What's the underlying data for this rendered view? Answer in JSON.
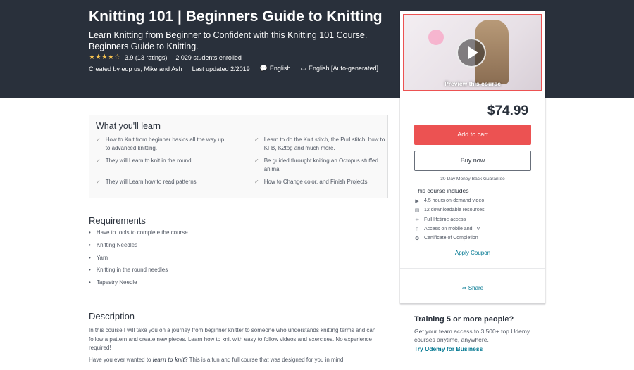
{
  "header": {
    "title": "Knitting 101 | Beginners Guide to Knitting",
    "subtitle": "Learn Knitting from Beginner to Confident with this Knitting 101 Course. Beginners Guide to Knitting.",
    "stars": "★★★★☆",
    "rating": "3.9 (13 ratings)",
    "enrolled": "2,029 students enrolled",
    "created_by": "Created by eqp us, Mike and Ash",
    "last_updated": "Last updated 2/2019",
    "language": "English",
    "captions": "English [Auto-generated]"
  },
  "sidebar": {
    "preview_label": "Preview this course",
    "price": "$74.99",
    "add_to_cart": "Add to cart",
    "buy_now": "Buy now",
    "guarantee": "30-Day Money-Back Guarantee",
    "includes_title": "This course includes",
    "includes": [
      {
        "icon": "video-icon",
        "glyph": "▶",
        "label": "4.5 hours on-demand video"
      },
      {
        "icon": "file-icon",
        "glyph": "▤",
        "label": "12 downloadable resources"
      },
      {
        "icon": "infinity-icon",
        "glyph": "∞",
        "label": "Full lifetime access"
      },
      {
        "icon": "mobile-icon",
        "glyph": "▯",
        "label": "Access on mobile and TV"
      },
      {
        "icon": "certificate-icon",
        "glyph": "✪",
        "label": "Certificate of Completion"
      }
    ],
    "apply_coupon": "Apply Coupon",
    "share": "Share"
  },
  "training": {
    "title": "Training 5 or more people?",
    "text": "Get your team access to 3,500+ top Udemy courses anytime, anywhere.",
    "link": "Try Udemy for Business"
  },
  "learn": {
    "title": "What you'll learn",
    "items": [
      "How to Knit from beginner basics all the way up to advanced knitting.",
      "Learn to do the Knit stitch, the Purl stitch, how to KFB, K2tog and much more.",
      "They will Learn to knit in the round",
      "Be guided throught kniting an Octopus stuffed animal",
      "They will Learn how to read patterns",
      "How to Change color, and Finish Projects"
    ]
  },
  "requirements": {
    "title": "Requirements",
    "items": [
      "Have to tools to complete the course",
      "Knitting Needles",
      "Yarn",
      "Knitting in the round needles",
      "Tapestry Needle"
    ]
  },
  "description": {
    "title": "Description",
    "p1": "In this course I will take you on a journey from beginner knitter to someone who understands knitting terms and can follow a pattern and create new pieces.  Learn how to knit  with easy to follow videos and exercises. No experience required!",
    "p2_pre": "Have you ever wanted to ",
    "p2_em": "learn to knit",
    "p2_post": "? This is a fun and full course that was designed for you in mind."
  },
  "colors": {
    "header_bg": "#29303b",
    "accent_red": "#ec5252",
    "link_blue": "#007791",
    "star": "#f4c150"
  }
}
